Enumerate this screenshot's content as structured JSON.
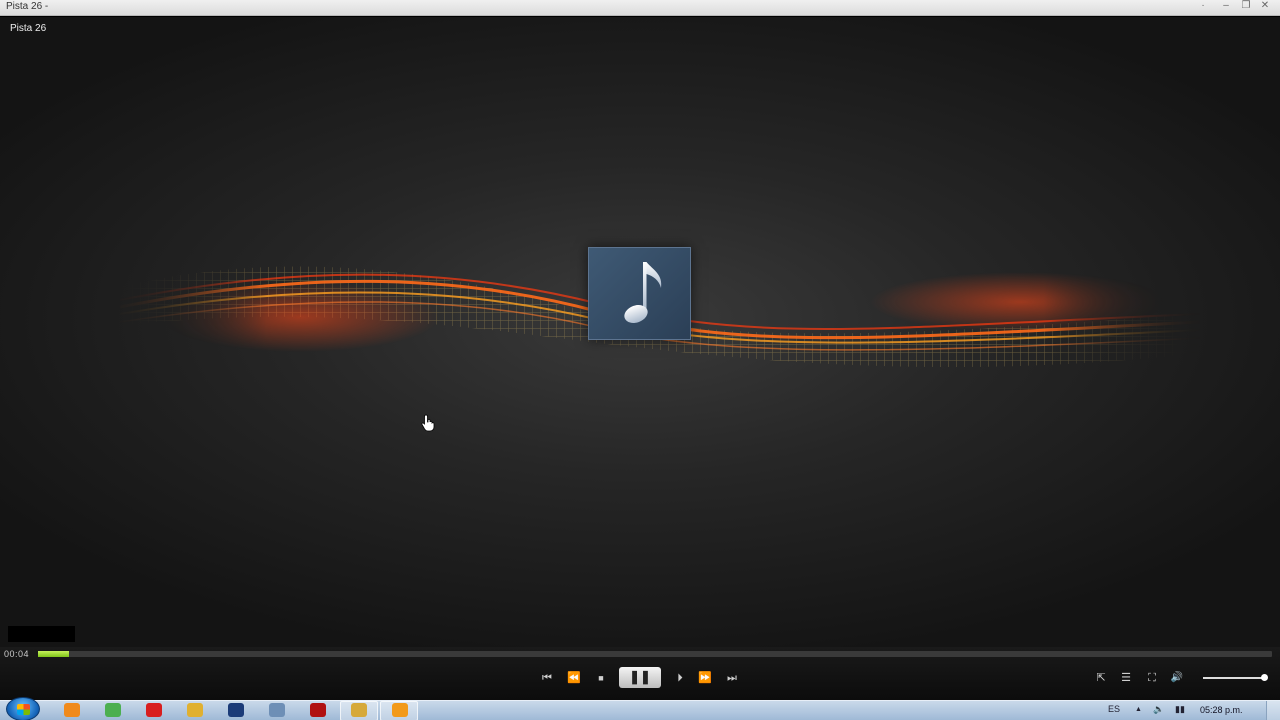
{
  "window": {
    "title": "Pista 26 -",
    "minimize_glyph": "–",
    "restore_glyph": "❐",
    "close_glyph": "✕"
  },
  "stage": {
    "track_label": "Pista 26",
    "album_art_icon": "music-note-icon"
  },
  "playback": {
    "elapsed": "00:04",
    "progress_fraction": 0.025,
    "volume_fraction": 0.95
  },
  "controls": {
    "previous": "⏮",
    "rewind": "⏪",
    "stop": "■",
    "pause": "❚❚",
    "next_frame": "⏵",
    "fast_forward": "⏩",
    "skip_next": "⏭",
    "switch_to_library": "⇱",
    "playlist": "☰",
    "fullscreen": "⛶",
    "volume": "🔊"
  },
  "taskbar": {
    "language": "ES",
    "tray_chevron": "▲",
    "clock": "05:28 p.m.",
    "apps": [
      {
        "name": "media-player-app",
        "color": "#f08a1c"
      },
      {
        "name": "chrome-app",
        "color": "#4caf50"
      },
      {
        "name": "opera-app",
        "color": "#d81e1e"
      },
      {
        "name": "r-app",
        "color": "#e0b030"
      },
      {
        "name": "photoshop-app",
        "color": "#1b3b78"
      },
      {
        "name": "explorer-app",
        "color": "#6e8fb6"
      },
      {
        "name": "record-app",
        "color": "#b01010"
      },
      {
        "name": "folder-app",
        "color": "#d6a93a"
      },
      {
        "name": "wmp-app",
        "color": "#f29a1a"
      }
    ]
  }
}
